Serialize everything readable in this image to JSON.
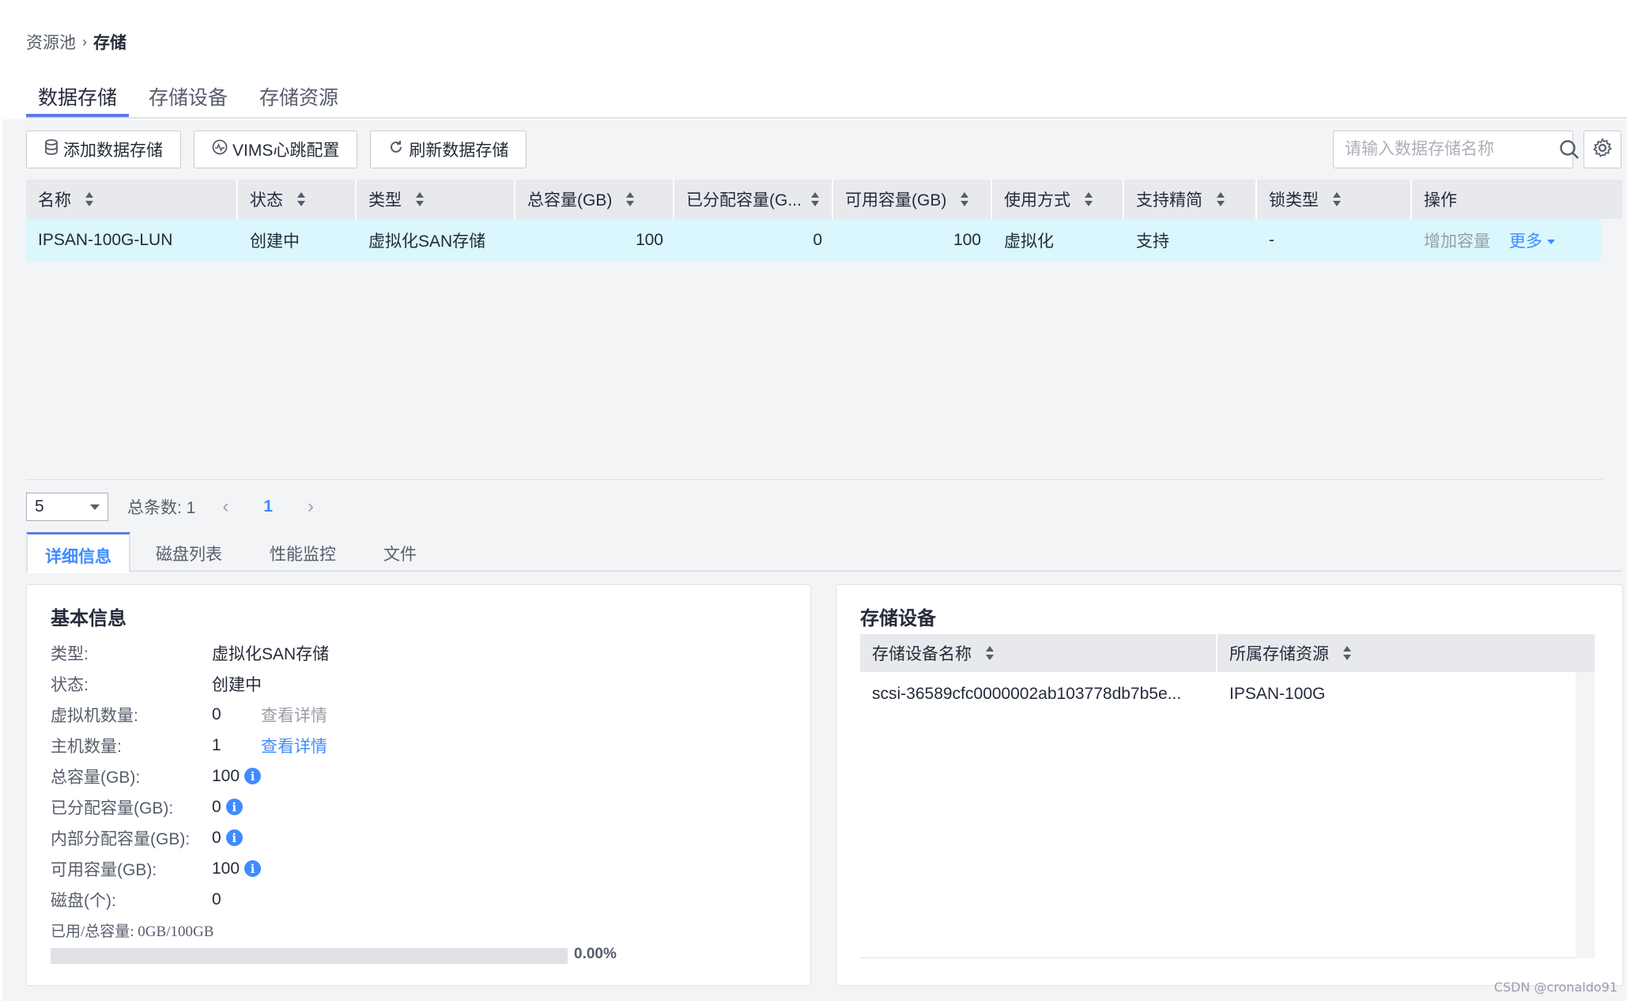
{
  "breadcrumb": {
    "parent": "资源池",
    "separator": "›",
    "current": "存储"
  },
  "top_tabs": [
    {
      "label": "数据存储",
      "active": true
    },
    {
      "label": "存储设备",
      "active": false
    },
    {
      "label": "存储资源",
      "active": false
    }
  ],
  "toolbar": {
    "add_label": "添加数据存储",
    "vims_label": "VIMS心跳配置",
    "refresh_label": "刷新数据存储",
    "search_placeholder": "请输入数据存储名称"
  },
  "grid": {
    "columns": [
      "名称",
      "状态",
      "类型",
      "总容量(GB)",
      "已分配容量(G...",
      "可用容量(GB)",
      "使用方式",
      "支持精简",
      "锁类型",
      "操作"
    ],
    "rows": [
      {
        "name": "IPSAN-100G-LUN",
        "status": "创建中",
        "type": "虚拟化SAN存储",
        "total": "100",
        "allocated": "0",
        "available": "100",
        "usage": "虚拟化",
        "thin": "支持",
        "lock": "-",
        "action_expand": "增加容量",
        "action_more": "更多"
      }
    ]
  },
  "pager": {
    "page_size": "5",
    "total_label": "总条数: 1",
    "current_page": "1"
  },
  "sub_tabs": [
    {
      "label": "详细信息",
      "active": true
    },
    {
      "label": "磁盘列表",
      "active": false
    },
    {
      "label": "性能监控",
      "active": false
    },
    {
      "label": "文件",
      "active": false
    }
  ],
  "basic_info": {
    "title": "基本信息",
    "type_label": "类型:",
    "type_value": "虚拟化SAN存储",
    "status_label": "状态:",
    "status_value": "创建中",
    "vm_count_label": "虚拟机数量:",
    "vm_count_value": "0",
    "vm_detail_link": "查看详情",
    "host_count_label": "主机数量:",
    "host_count_value": "1",
    "host_detail_link": "查看详情",
    "total_label": "总容量(GB):",
    "total_value": "100",
    "allocated_label": "已分配容量(GB):",
    "allocated_value": "0",
    "internal_label": "内部分配容量(GB):",
    "internal_value": "0",
    "available_label": "可用容量(GB):",
    "available_value": "100",
    "disk_label": "磁盘(个):",
    "disk_value": "0",
    "usage_label": "已用/总容量: 0GB/100GB",
    "usage_fraction": 0.0,
    "usage_pct": "0.00%"
  },
  "storage_device": {
    "title": "存储设备",
    "columns": [
      "存储设备名称",
      "所属存储资源"
    ],
    "rows": [
      {
        "device": "scsi-36589cfc0000002ab103778db7b5e...",
        "resource": "IPSAN-100G"
      }
    ]
  },
  "watermark": "CSDN @cronaldo91",
  "colors": {
    "accent": "#5e7ce0",
    "link": "#3f8cff",
    "row_highlight": "#d9f7fc",
    "header_bg": "#e8e9ed"
  }
}
